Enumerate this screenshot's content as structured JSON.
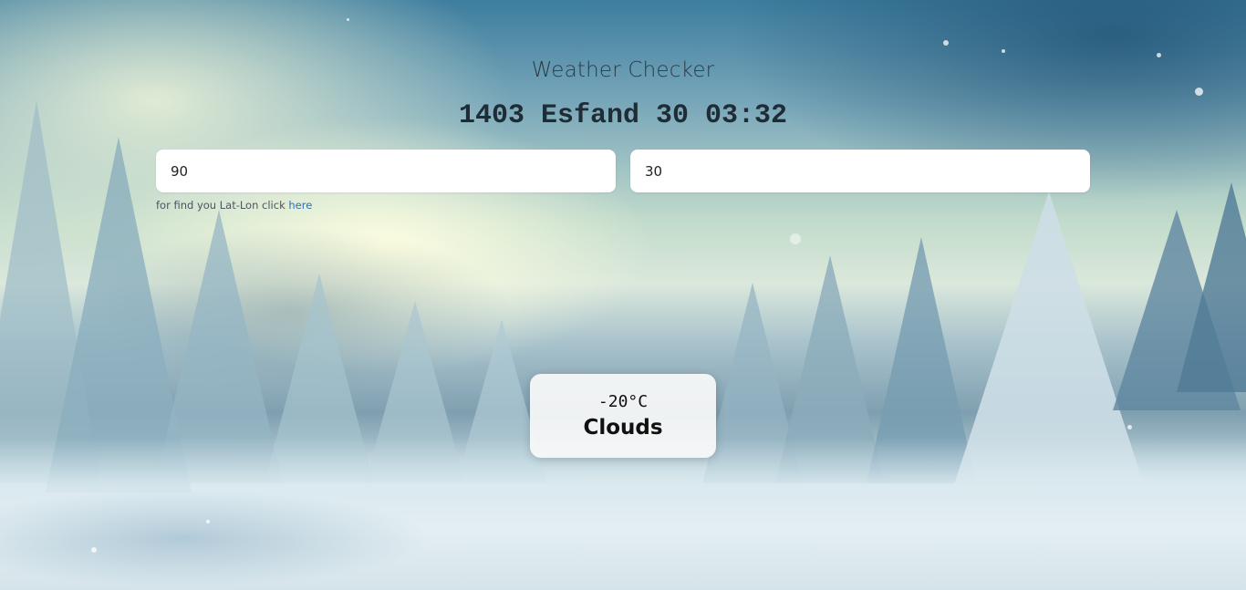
{
  "app": {
    "title": "Weather Checker",
    "clock": "1403 Esfand 30 03:32"
  },
  "inputs": {
    "latitude_value": "90",
    "longitude_value": "30"
  },
  "hint": {
    "text": "for find you Lat-Lon click ",
    "link_label": "here"
  },
  "weather": {
    "temperature": "-20°C",
    "condition": "Clouds"
  },
  "colors": {
    "link": "#2a6fb5",
    "title_text": "#2c3a46",
    "card_background": "#f8f8f8"
  },
  "background": {
    "theme": "snowy pine forest"
  }
}
